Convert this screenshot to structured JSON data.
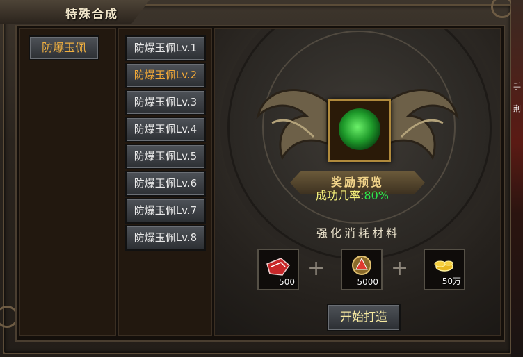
{
  "window": {
    "title": "特殊合成"
  },
  "categories": [
    {
      "label": "防爆玉佩"
    }
  ],
  "levels": [
    {
      "label": "防爆玉佩Lv.1",
      "active": false
    },
    {
      "label": "防爆玉佩Lv.2",
      "active": true
    },
    {
      "label": "防爆玉佩Lv.3",
      "active": false
    },
    {
      "label": "防爆玉佩Lv.4",
      "active": false
    },
    {
      "label": "防爆玉佩Lv.5",
      "active": false
    },
    {
      "label": "防爆玉佩Lv.6",
      "active": false
    },
    {
      "label": "防爆玉佩Lv.7",
      "active": false
    },
    {
      "label": "防爆玉佩Lv.8",
      "active": false
    }
  ],
  "preview": {
    "item_icon": "jade-pendant-icon",
    "banner": "奖励预览"
  },
  "success": {
    "label": "成功几率:",
    "value": "80%"
  },
  "materials_title": "强化消耗材料",
  "materials": [
    {
      "icon": "red-gem-material-icon",
      "count": "500"
    },
    {
      "icon": "red-crest-material-icon",
      "count": "5000"
    },
    {
      "icon": "gold-coins-icon",
      "count": "50万"
    }
  ],
  "craft_button": "开始打造",
  "side_text": [
    "手",
    "荆"
  ],
  "colors": {
    "active_text": "#f0a838",
    "rate_value": "#2ee64a",
    "rate_label": "#f3ef7a"
  }
}
